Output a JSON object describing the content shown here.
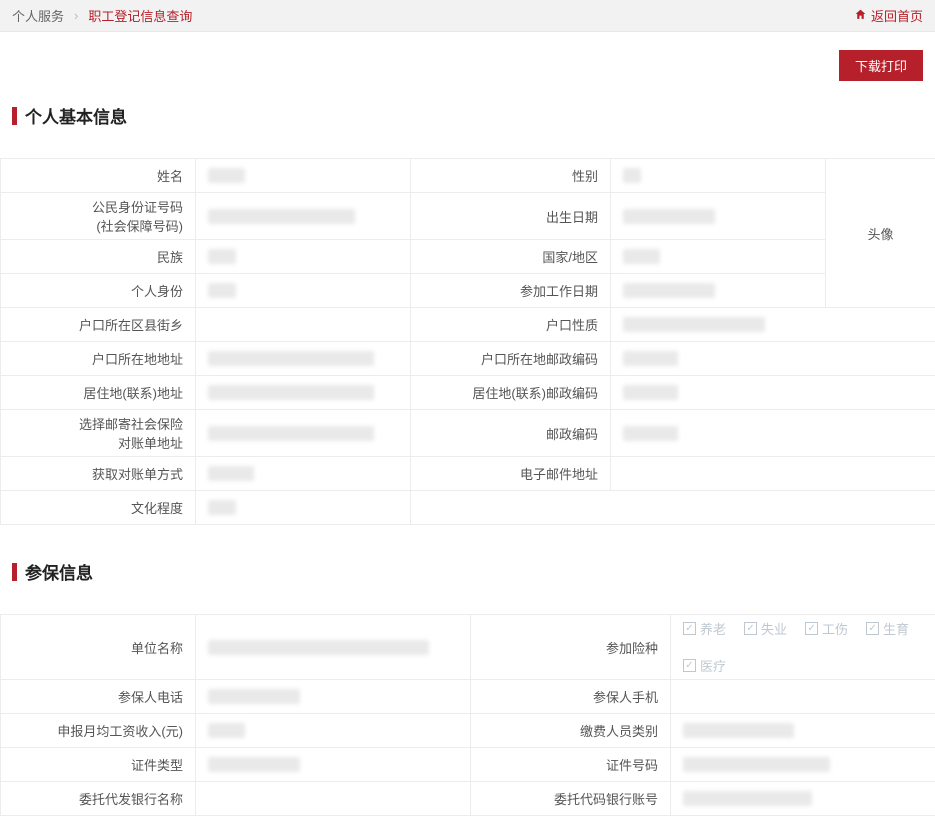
{
  "breadcrumb": {
    "root": "个人服务",
    "sep": "›",
    "current": "职工登记信息查询",
    "back_home": "返回首页"
  },
  "buttons": {
    "download_print": "下载打印"
  },
  "sections": {
    "basic": "个人基本信息",
    "insure": "参保信息"
  },
  "avatar_label": "头像",
  "basic_labels": {
    "name": "姓名",
    "gender": "性别",
    "idno": "公民身份证号码\n(社会保障号码)",
    "birth": "出生日期",
    "ethnic": "民族",
    "country": "国家/地区",
    "identity": "个人身份",
    "work_date": "参加工作日期",
    "hukou_area": "户口所在区县街乡",
    "hukou_type": "户口性质",
    "hukou_addr": "户口所在地地址",
    "hukou_zip": "户口所在地邮政编码",
    "live_addr": "居住地(联系)地址",
    "live_zip": "居住地(联系)邮政编码",
    "mail_addr": "选择邮寄社会保险\n对账单地址",
    "zip": "邮政编码",
    "bill_method": "获取对账单方式",
    "email": "电子邮件地址",
    "edu": "文化程度"
  },
  "basic_values": {
    "name": "████",
    "gender": "██",
    "idno": "████████████████",
    "birth": "██████████",
    "ethnic": "███",
    "country": "████",
    "identity": "███",
    "work_date": "██████████",
    "hukou_area": "",
    "hukou_type": "███ ████████████",
    "hukou_addr": "██████████████████",
    "hukou_zip": "██████",
    "live_addr": "██████████████████",
    "live_zip": "██████",
    "mail_addr": "██████████████████",
    "zip": "██████",
    "bill_method": "█████",
    "email": "",
    "edu": "███"
  },
  "insure_labels": {
    "company": "单位名称",
    "types": "参加险种",
    "phone": "参保人电话",
    "mobile": "参保人手机",
    "avg_income": "申报月均工资收入(元)",
    "payer_type": "缴费人员类别",
    "cert_type": "证件类型",
    "cert_no": "证件号码",
    "bank_name": "委托代发银行名称",
    "bank_acct": "委托代码银行账号"
  },
  "insure_values": {
    "company": "████████████████████████",
    "phone": "██████████",
    "mobile": "",
    "avg_income": "████",
    "payer_type": "████████████",
    "cert_type": "██████████",
    "cert_no": "████████████████",
    "bank_name": "",
    "bank_acct": "██████████████"
  },
  "insure_types": {
    "pension": "养老",
    "unemploy": "失业",
    "injury": "工伤",
    "maternity": "生育",
    "medical": "医疗"
  }
}
